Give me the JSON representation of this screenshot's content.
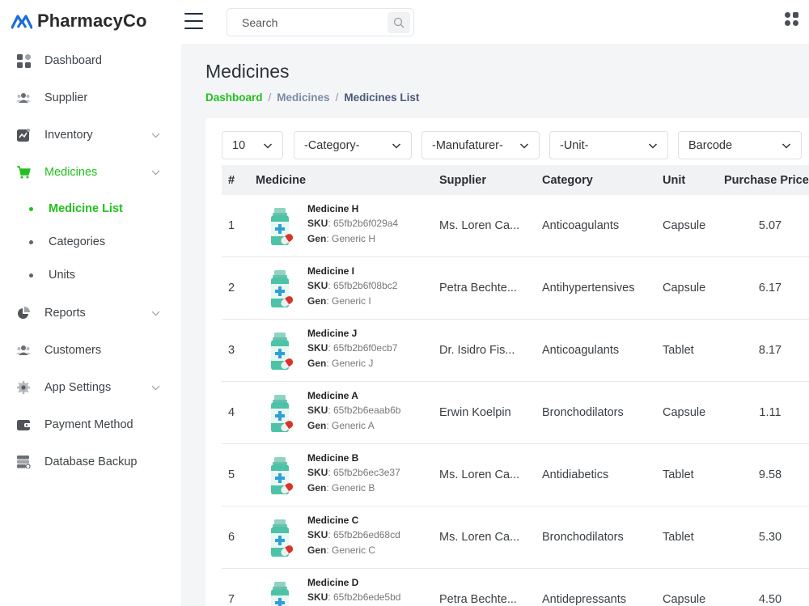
{
  "app": {
    "name": "PharmacyCo"
  },
  "search": {
    "placeholder": "Search"
  },
  "sidebar": {
    "items": [
      {
        "label": "Dashboard"
      },
      {
        "label": "Supplier"
      },
      {
        "label": "Inventory"
      },
      {
        "label": "Medicines"
      },
      {
        "label": "Reports"
      },
      {
        "label": "Customers"
      },
      {
        "label": "App Settings"
      },
      {
        "label": "Payment Method"
      },
      {
        "label": "Database Backup"
      }
    ],
    "sub_items": [
      {
        "label": "Medicine List"
      },
      {
        "label": "Categories"
      },
      {
        "label": "Units"
      }
    ]
  },
  "page": {
    "title": "Medicines",
    "breadcrumb": {
      "home": "Dashboard",
      "sep": "/",
      "middle": "Medicines",
      "current": "Medicines List"
    }
  },
  "filters": {
    "page_size": "10",
    "category": "-Category-",
    "manufacturer": "-Manufaturer-",
    "unit": "-Unit-",
    "barcode": "Barcode"
  },
  "table": {
    "headers": {
      "num": "#",
      "medicine": "Medicine",
      "supplier": "Supplier",
      "category": "Category",
      "unit": "Unit",
      "price": "Purchase Price"
    },
    "sku_label": "SKU",
    "gen_label": "Gen",
    "rows": [
      {
        "num": "1",
        "name": "Medicine H",
        "sku": ": 65fb2b6f029a4",
        "gen": ": Generic H",
        "supplier": "Ms. Loren Ca...",
        "category": "Anticoagulants",
        "unit": "Capsule",
        "price": "5.07"
      },
      {
        "num": "2",
        "name": "Medicine I",
        "sku": ": 65fb2b6f08bc2",
        "gen": ": Generic I",
        "supplier": "Petra Bechte...",
        "category": "Antihypertensives",
        "unit": "Capsule",
        "price": "6.17"
      },
      {
        "num": "3",
        "name": "Medicine J",
        "sku": ": 65fb2b6f0ecb7",
        "gen": ": Generic J",
        "supplier": "Dr. Isidro Fis...",
        "category": "Anticoagulants",
        "unit": "Tablet",
        "price": "8.17"
      },
      {
        "num": "4",
        "name": "Medicine A",
        "sku": ": 65fb2b6eaab6b",
        "gen": ": Generic A",
        "supplier": "Erwin Koelpin",
        "category": "Bronchodilators",
        "unit": "Capsule",
        "price": "1.11"
      },
      {
        "num": "5",
        "name": "Medicine B",
        "sku": ": 65fb2b6ec3e37",
        "gen": ": Generic B",
        "supplier": "Ms. Loren Ca...",
        "category": "Antidiabetics",
        "unit": "Tablet",
        "price": "9.58"
      },
      {
        "num": "6",
        "name": "Medicine C",
        "sku": ": 65fb2b6ed68cd",
        "gen": ": Generic C",
        "supplier": "Ms. Loren Ca...",
        "category": "Bronchodilators",
        "unit": "Tablet",
        "price": "5.30"
      },
      {
        "num": "7",
        "name": "Medicine D",
        "sku": ": 65fb2b6ede5bd",
        "gen": "",
        "supplier": "Petra Bechte...",
        "category": "Antidepressants",
        "unit": "Capsule",
        "price": "4.50"
      }
    ]
  },
  "colors": {
    "accent": "#22c11f",
    "brand_logo": "#1a6fd6"
  }
}
